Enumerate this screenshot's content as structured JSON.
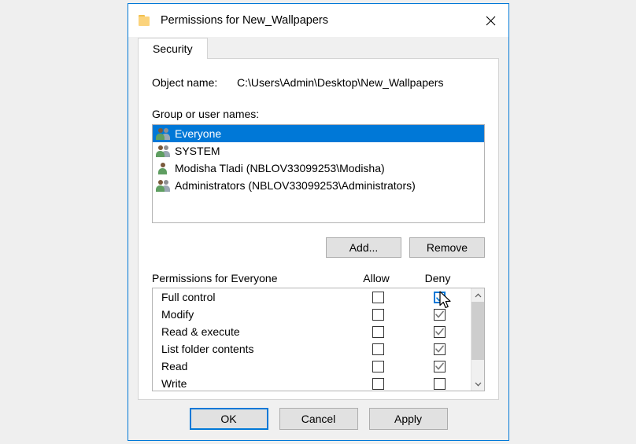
{
  "dialog": {
    "title": "Permissions for New_Wallpapers",
    "folder_icon": "folder-icon",
    "close_icon": "close-icon",
    "accent_color": "#0078d7"
  },
  "tabs": [
    {
      "label": "Security",
      "selected": true
    }
  ],
  "object_name": {
    "label": "Object name:",
    "value": "C:\\Users\\Admin\\Desktop\\New_Wallpapers"
  },
  "group_list": {
    "label": "Group or user names:",
    "items": [
      {
        "name": "Everyone",
        "icon": "group-icon",
        "selected": true
      },
      {
        "name": "SYSTEM",
        "icon": "group-icon",
        "selected": false
      },
      {
        "name": "Modisha Tladi (NBLOV33099253\\Modisha)",
        "icon": "user-icon",
        "selected": false
      },
      {
        "name": "Administrators (NBLOV33099253\\Administrators)",
        "icon": "group-icon",
        "selected": false
      }
    ]
  },
  "list_actions": {
    "add_label": "Add...",
    "remove_label": "Remove"
  },
  "permissions": {
    "header_label": "Permissions for Everyone",
    "allow_label": "Allow",
    "deny_label": "Deny",
    "rows": [
      {
        "name": "Full control",
        "allow": false,
        "deny": true,
        "deny_focused": true
      },
      {
        "name": "Modify",
        "allow": false,
        "deny": true,
        "deny_focused": false
      },
      {
        "name": "Read & execute",
        "allow": false,
        "deny": true,
        "deny_focused": false
      },
      {
        "name": "List folder contents",
        "allow": false,
        "deny": true,
        "deny_focused": false
      },
      {
        "name": "Read",
        "allow": false,
        "deny": true,
        "deny_focused": false
      },
      {
        "name": "Write",
        "allow": false,
        "deny": false,
        "deny_focused": false
      }
    ],
    "scrollbar": {
      "up_icon": "chevron-up-icon",
      "down_icon": "chevron-down-icon"
    }
  },
  "footer": {
    "ok_label": "OK",
    "cancel_label": "Cancel",
    "apply_label": "Apply"
  },
  "cursor": {
    "icon": "arrow-cursor"
  }
}
